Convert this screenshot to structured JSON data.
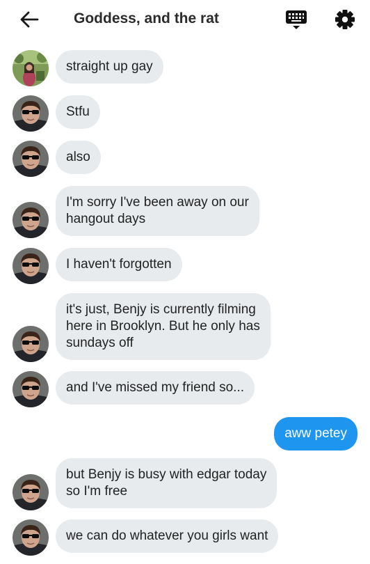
{
  "header": {
    "title": "Goddess, and the rat",
    "icons": [
      "back-arrow-icon",
      "keyboard-icon",
      "gear-icon"
    ]
  },
  "colors": {
    "incoming_bubble": "#e7ebee",
    "outgoing_bubble": "#1e96f0"
  },
  "messages": [
    {
      "sender": "goddess",
      "text": "straight up gay"
    },
    {
      "sender": "rat",
      "text": "Stfu"
    },
    {
      "sender": "rat",
      "text": "also"
    },
    {
      "sender": "rat",
      "text": "I'm sorry I've been away on our\nhangout days"
    },
    {
      "sender": "rat",
      "text": "I haven't forgotten"
    },
    {
      "sender": "rat",
      "text": "it's just, Benjy is currently filming\nhere in Brooklyn. But he only has\nsundays off"
    },
    {
      "sender": "rat",
      "text": "and I've missed my friend so..."
    },
    {
      "sender": "me",
      "text": "aww petey"
    },
    {
      "sender": "rat",
      "text": "but Benjy is busy with edgar today\nso I'm free"
    },
    {
      "sender": "rat",
      "text": "we can do whatever you girls want"
    }
  ]
}
